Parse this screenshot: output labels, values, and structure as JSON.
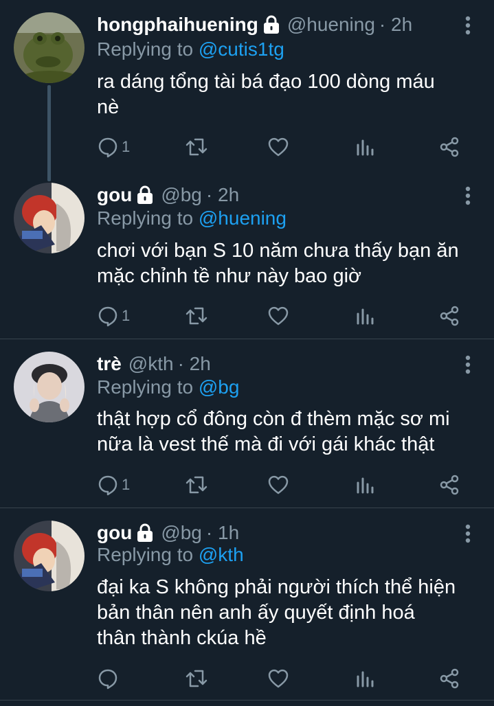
{
  "colors": {
    "background": "#15202b",
    "secondary_text": "#8899a6",
    "mention": "#1da1f2",
    "divider": "#38444d",
    "thread_line": "#3d5466"
  },
  "replying_prefix": "Replying to ",
  "tweets": [
    {
      "name": "hongphaihuening",
      "protected": true,
      "handle": "@huening",
      "time": "· 2h",
      "reply_to": "@cutis1tg",
      "text_lines": [
        "ra dáng tổng tài bá đạo 100 dòng máu",
        "nè"
      ],
      "reply_count": "1",
      "avatar_icon": "green-frog-avatar"
    },
    {
      "name": "gou",
      "protected": true,
      "handle": "@bg",
      "time": "· 2h",
      "reply_to": "@huening",
      "text_lines": [
        "chơi với bạn S 10 năm chưa thấy bạn ăn",
        "mặc chỉnh tề như này bao giờ"
      ],
      "reply_count": "1",
      "avatar_icon": "anime-character-avatar"
    },
    {
      "name": "trè",
      "protected": false,
      "handle": "@kth",
      "time": "· 2h",
      "reply_to": "@bg",
      "text_lines": [
        "thật hợp cổ đông còn đ thèm mặc sơ mi",
        "nữa là vest thế mà đi với gái khác thật"
      ],
      "reply_count": "1",
      "avatar_icon": "person-photo-avatar"
    },
    {
      "name": "gou",
      "protected": true,
      "handle": "@bg",
      "time": "· 1h",
      "reply_to": "@kth",
      "text_lines": [
        "đại ka S không phải người thích thể hiện",
        "bản thân nên anh ấy quyết định hoá",
        "thân thành ckúa hề"
      ],
      "reply_count": "",
      "avatar_icon": "anime-character-avatar"
    }
  ]
}
